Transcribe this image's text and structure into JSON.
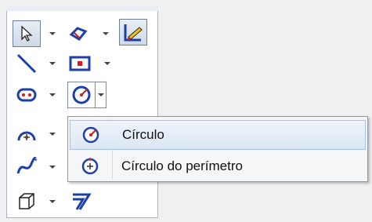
{
  "toolbar": {
    "rows": [
      {
        "buttons": [
          "select-arrow-icon",
          "smart-dimension-icon",
          "sketch-icon"
        ]
      },
      {
        "buttons": [
          "line-icon",
          "rectangle-icon"
        ]
      },
      {
        "buttons": [
          "slot-icon",
          "circle-icon"
        ]
      },
      {
        "buttons": [
          "arc-icon"
        ]
      },
      {
        "buttons": [
          "spline-icon"
        ]
      },
      {
        "buttons": [
          "3d-box-icon",
          "offset-entities-icon"
        ]
      }
    ]
  },
  "flyout": {
    "items": [
      {
        "label": "Círculo",
        "icon": "circle-center-icon",
        "hover": true
      },
      {
        "label": "Círculo do perímetro",
        "icon": "perimeter-circle-icon",
        "hover": false
      }
    ]
  },
  "colors": {
    "accent_blue": "#1e3fa8",
    "accent_red": "#d21e1e",
    "highlight_bg": "#dce7f4",
    "pencil_yellow": "#f2c200"
  }
}
